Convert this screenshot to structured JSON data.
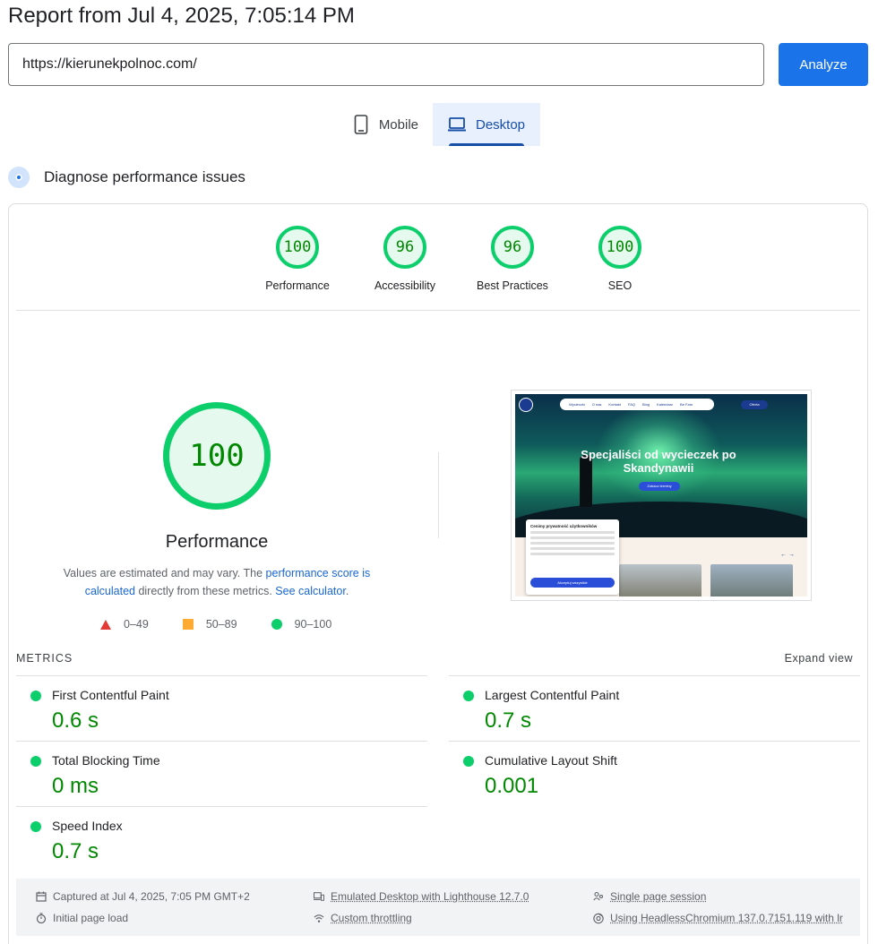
{
  "header": {
    "title": "Report from Jul 4, 2025, 7:05:14 PM"
  },
  "url_bar": {
    "value": "https://kierunekpolnoc.com/",
    "analyze_label": "Analyze"
  },
  "device_tabs": [
    {
      "label": "Mobile",
      "active": false
    },
    {
      "label": "Desktop",
      "active": true
    }
  ],
  "diagnose": {
    "label": "Diagnose performance issues"
  },
  "categories": [
    {
      "score": "100",
      "label": "Performance"
    },
    {
      "score": "96",
      "label": "Accessibility"
    },
    {
      "score": "96",
      "label": "Best Practices"
    },
    {
      "score": "100",
      "label": "SEO"
    }
  ],
  "performance": {
    "score": "100",
    "label": "Performance",
    "note_prefix": "Values are estimated and may vary. The ",
    "note_link1": "performance score is calculated",
    "note_mid": " directly from these metrics. ",
    "note_link2": "See calculator",
    "note_suffix": "."
  },
  "legend": [
    {
      "shape": "triangle",
      "range": "0–49",
      "color": "#e53935"
    },
    {
      "shape": "square",
      "range": "50–89",
      "color": "#ffaa33"
    },
    {
      "shape": "circle",
      "range": "90–100",
      "color": "#0cce6b"
    }
  ],
  "screenshot": {
    "nav_items": [
      "Wycieczki",
      "O nas",
      "Kontakt",
      "FAQ",
      "Blog",
      "Kalendarz",
      "Be Fam"
    ],
    "cta": "Oferta",
    "hero_title": "Specjaliści od wycieczek po Skandynawii",
    "hero_button": "Zobacz terminy",
    "cookie_title": "Cenimy prywatność użytkowników",
    "cookie_accept": "Akceptuj wszystkie"
  },
  "metrics": {
    "heading": "METRICS",
    "expand_label": "Expand view",
    "items": [
      {
        "label": "First Contentful Paint",
        "value": "0.6 s"
      },
      {
        "label": "Largest Contentful Paint",
        "value": "0.7 s"
      },
      {
        "label": "Total Blocking Time",
        "value": "0 ms"
      },
      {
        "label": "Cumulative Layout Shift",
        "value": "0.001"
      },
      {
        "label": "Speed Index",
        "value": "0.7 s"
      }
    ]
  },
  "footer": {
    "captured": "Captured at Jul 4, 2025, 7:05 PM GMT+2",
    "initial_load": "Initial page load",
    "emulated": "Emulated Desktop with Lighthouse 12.7.0",
    "throttling": "Custom throttling",
    "session": "Single page session",
    "browser": "Using HeadlessChromium 137.0.7151.119 with lr"
  },
  "colors": {
    "pass": "#0cce6b",
    "pass_text": "#008800",
    "accent": "#1a73e8"
  }
}
